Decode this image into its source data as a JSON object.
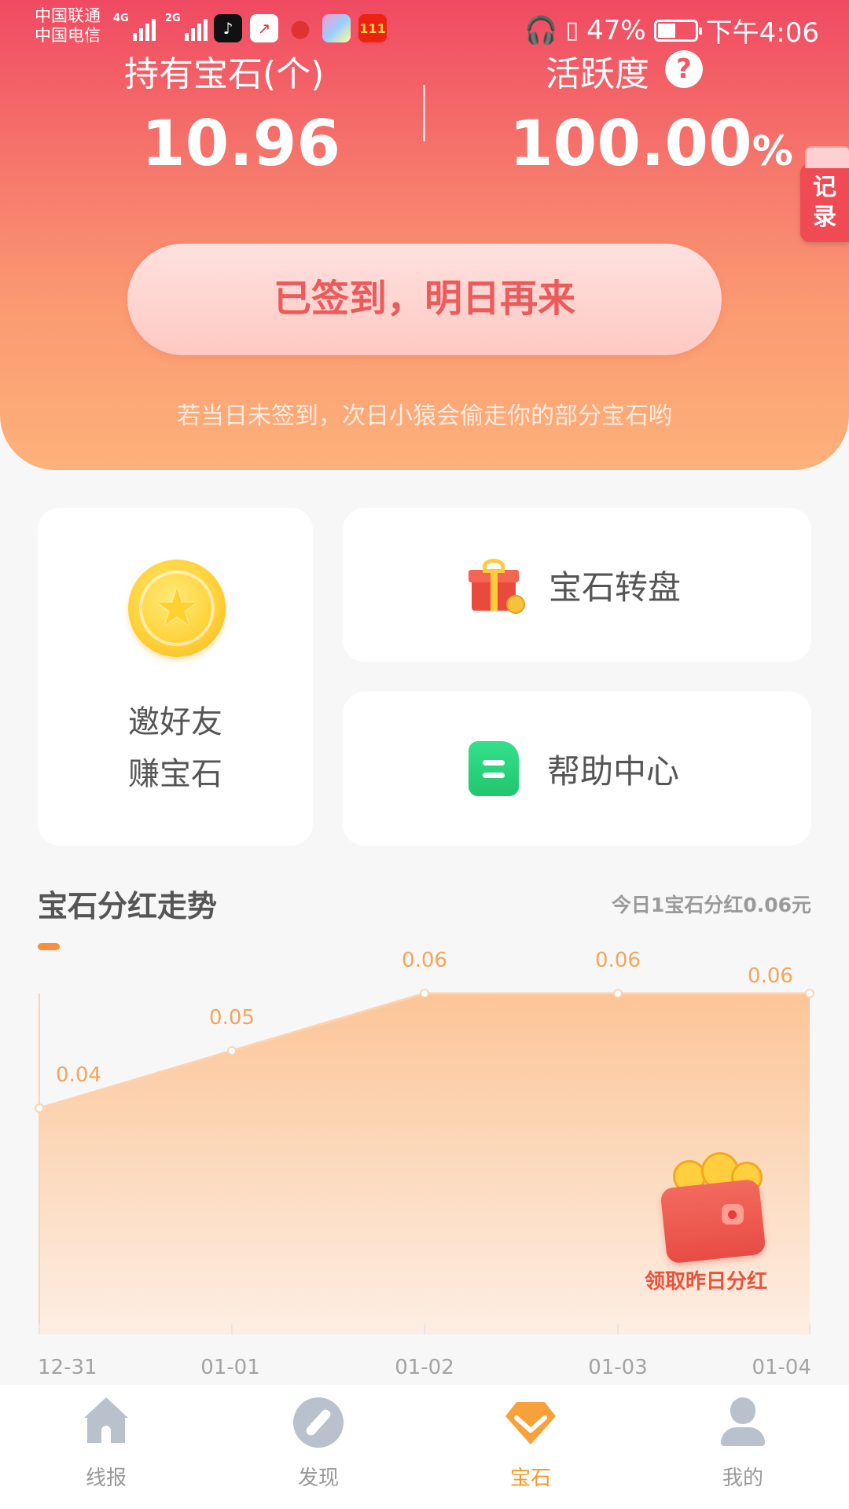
{
  "status_bar": {
    "carrier1": "中国联通",
    "carrier2": "中国电信",
    "net1": "4G",
    "net2": "2G",
    "battery": "47%",
    "time": "下午4:06"
  },
  "stats": {
    "gems_label": "持有宝石(个)",
    "gems_value": "10.96",
    "activity_label": "活跃度",
    "activity_value": "100.00",
    "activity_unit": "%",
    "help_icon": "?"
  },
  "record_tab": {
    "line1": "记",
    "line2": "录"
  },
  "signin": {
    "button_label": "已签到，明日再来",
    "tip": "若当日未签到，次日小猿会偷走你的部分宝石哟"
  },
  "cards": {
    "invite_line1": "邀好友",
    "invite_line2": "赚宝石",
    "wheel_label": "宝石转盘",
    "help_label": "帮助中心"
  },
  "trend": {
    "title": "宝石分红走势",
    "note": "今日1宝石分红0.06元",
    "reward_label": "领取昨日分红"
  },
  "chart_data": {
    "type": "area",
    "title": "宝石分红走势",
    "x": [
      "12-31",
      "01-01",
      "01-02",
      "01-03",
      "01-04"
    ],
    "series": [
      {
        "values": [
          0.04,
          0.05,
          0.06,
          0.06,
          0.06
        ]
      }
    ],
    "data_labels": [
      "0.04",
      "0.05",
      "0.06",
      "0.06",
      "0.06"
    ],
    "colors": {
      "fill_top": "#fcc597",
      "fill_bottom": "#fdeee3",
      "line": "#fcd3ad",
      "label": "#f3a55b"
    }
  },
  "bottom_nav": [
    {
      "label": "线报",
      "icon": "home-icon"
    },
    {
      "label": "发现",
      "icon": "compass-icon"
    },
    {
      "label": "宝石",
      "icon": "gem-icon",
      "active": true
    },
    {
      "label": "我的",
      "icon": "profile-icon"
    }
  ],
  "colors": {
    "accent": "#f59a2b",
    "header_top": "#f04a62",
    "header_bottom": "#fdb17a",
    "signin_text": "#ec5b5b"
  }
}
